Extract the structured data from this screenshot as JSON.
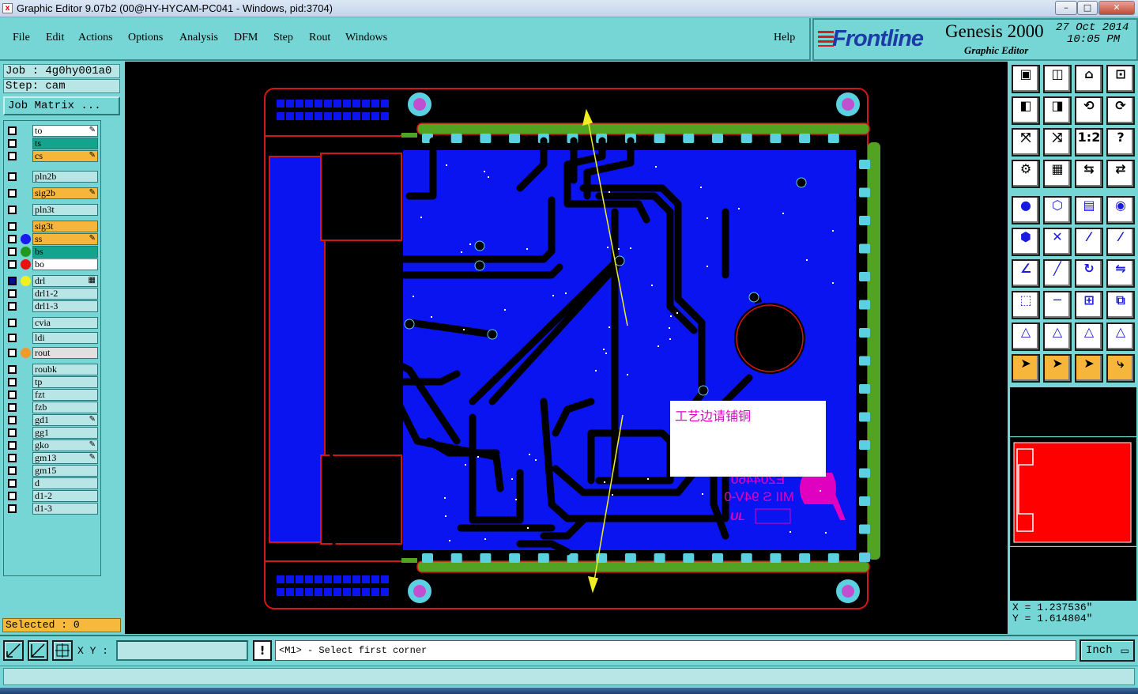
{
  "window": {
    "title": "Graphic Editor 9.07b2 (00@HY-HYCAM-PC041 - Windows, pid:3704)"
  },
  "menubar": {
    "items": [
      "File",
      "Edit",
      "Actions",
      "Options",
      "Analysis",
      "DFM",
      "Step",
      "Rout",
      "Windows"
    ],
    "help": "Help"
  },
  "brand": {
    "logo": "Frontline",
    "product": "Genesis 2000",
    "subtitle": "Graphic Editor",
    "date": "27 Oct 2014",
    "time": "10:05 PM"
  },
  "job": {
    "job_line": "Job : 4g0hy001a0",
    "step_line": "Step: cam",
    "matrix_button": "Job Matrix ..."
  },
  "layers": [
    {
      "name": "to",
      "color": "#ffffff",
      "mark": "pen"
    },
    {
      "name": "ts",
      "color": "#14a38d",
      "mark": ""
    },
    {
      "name": "cs",
      "color": "#f6b63b",
      "mark": "pen"
    },
    {
      "name": "pln2b",
      "color": "#b8e6e6",
      "mark": ""
    },
    {
      "name": "sig2b",
      "color": "#f6b63b",
      "mark": "pen"
    },
    {
      "name": "pln3t",
      "color": "#b8e6e6",
      "mark": ""
    },
    {
      "name": "sig3t",
      "color": "#f6b63b",
      "mark": ""
    },
    {
      "name": "ss",
      "color": "#f6b63b",
      "mark": "pen",
      "dot": "#1a1af0"
    },
    {
      "name": "bs",
      "color": "#14a38d",
      "mark": "",
      "dot": "#1f9a1f"
    },
    {
      "name": "bo",
      "color": "#ffffff",
      "mark": "",
      "dot": "#e81010"
    },
    {
      "name": "drl",
      "color": "#b8e6e6",
      "mark": "grid",
      "dot": "#f0f020",
      "checked": true
    },
    {
      "name": "drl1-2",
      "color": "#b8e6e6",
      "mark": ""
    },
    {
      "name": "drl1-3",
      "color": "#b8e6e6",
      "mark": ""
    },
    {
      "name": "cvia",
      "color": "#b8e6e6",
      "mark": ""
    },
    {
      "name": "ldi",
      "color": "#b8e6e6",
      "mark": ""
    },
    {
      "name": "rout",
      "color": "#e0e0e0",
      "mark": "",
      "dot": "#f39a2a"
    },
    {
      "name": "roubk",
      "color": "#b8e6e6",
      "mark": ""
    },
    {
      "name": "tp",
      "color": "#b8e6e6",
      "mark": ""
    },
    {
      "name": "fzt",
      "color": "#b8e6e6",
      "mark": ""
    },
    {
      "name": "fzb",
      "color": "#b8e6e6",
      "mark": ""
    },
    {
      "name": "gd1",
      "color": "#b8e6e6",
      "mark": "pen"
    },
    {
      "name": "gg1",
      "color": "#b8e6e6",
      "mark": ""
    },
    {
      "name": "gko",
      "color": "#b8e6e6",
      "mark": "pen"
    },
    {
      "name": "gm13",
      "color": "#b8e6e6",
      "mark": "pen"
    },
    {
      "name": "gm15",
      "color": "#b8e6e6",
      "mark": ""
    },
    {
      "name": "d",
      "color": "#b8e6e6",
      "mark": ""
    },
    {
      "name": "d1-2",
      "color": "#b8e6e6",
      "mark": ""
    },
    {
      "name": "d1-3",
      "color": "#b8e6e6",
      "mark": ""
    }
  ],
  "selection": {
    "label": "Selected : 0"
  },
  "annotation": {
    "text": "工艺边请铺铜"
  },
  "silkscreen": {
    "part": "E204460",
    "material": "MII S 94V-0",
    "brand": "UL"
  },
  "coordinates": {
    "x_line": "X = 1.237536\"",
    "y_line": "Y = 1.614804\""
  },
  "command": {
    "xy_label": "X Y :",
    "xy_value": "",
    "prompt": "<M1> - Select first corner",
    "unit": "Inch"
  },
  "colors": {
    "board_fill": "#0a14f0",
    "outline": "#d01818",
    "pad": "#5ad0e0",
    "green_rail": "#52a322",
    "text_magenta": "#e000c0"
  }
}
